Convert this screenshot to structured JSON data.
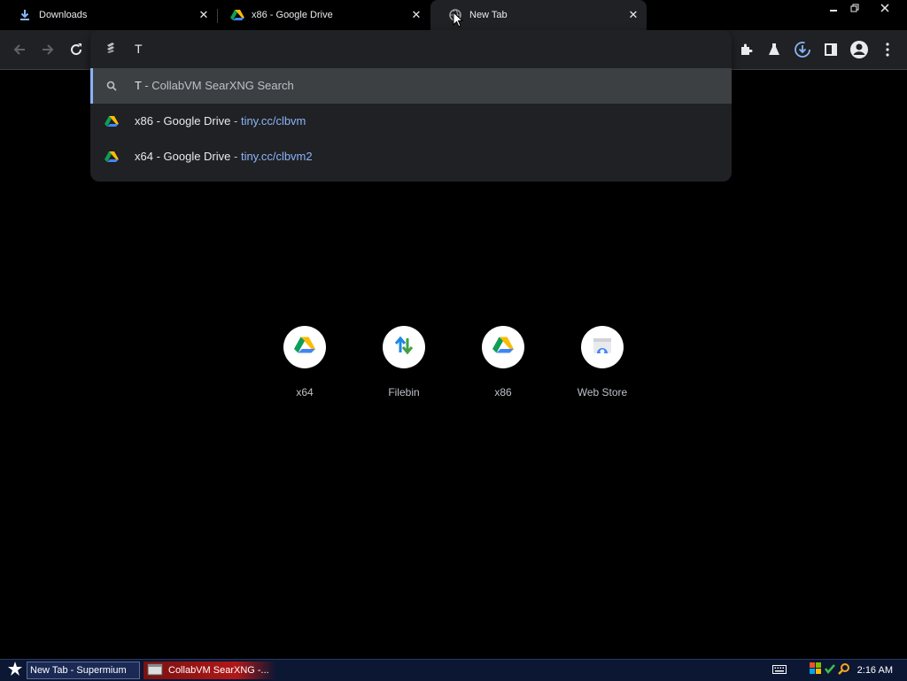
{
  "tabs": [
    {
      "title": "Downloads",
      "icon": "download-icon",
      "close": "✕"
    },
    {
      "title": "x86 - Google Drive",
      "icon": "google-drive-icon",
      "close": "✕"
    },
    {
      "title": "New Tab",
      "icon": "globe-icon",
      "close": "✕"
    }
  ],
  "omnibox": {
    "value": "T",
    "suggestions": [
      {
        "primary": "T",
        "separator": " - ",
        "secondary": "CollabVM SearXNG Search",
        "icon": "search-icon"
      },
      {
        "primary": "x86 - Google Drive",
        "separator": " - ",
        "url": "tiny.cc/clbvm",
        "icon": "google-drive-icon"
      },
      {
        "primary": "x64 - Google Drive",
        "separator": " - ",
        "url": "tiny.cc/clbvm2",
        "icon": "google-drive-icon"
      }
    ]
  },
  "shortcuts": [
    {
      "label": "x64",
      "icon": "google-drive-icon"
    },
    {
      "label": "Filebin",
      "icon": "up-down-arrows-icon"
    },
    {
      "label": "x86",
      "icon": "google-drive-icon"
    },
    {
      "label": "Web Store",
      "icon": "web-store-icon"
    }
  ],
  "taskbar": {
    "tasks": [
      {
        "label": "New Tab - Supermium"
      },
      {
        "label": "CollabVM SearXNG -..."
      }
    ],
    "clock": "2:16 AM"
  },
  "colors": {
    "accent": "#8ab4f8",
    "background": "#000000",
    "toolbar": "#202124",
    "taskbar": "#0b1733"
  }
}
